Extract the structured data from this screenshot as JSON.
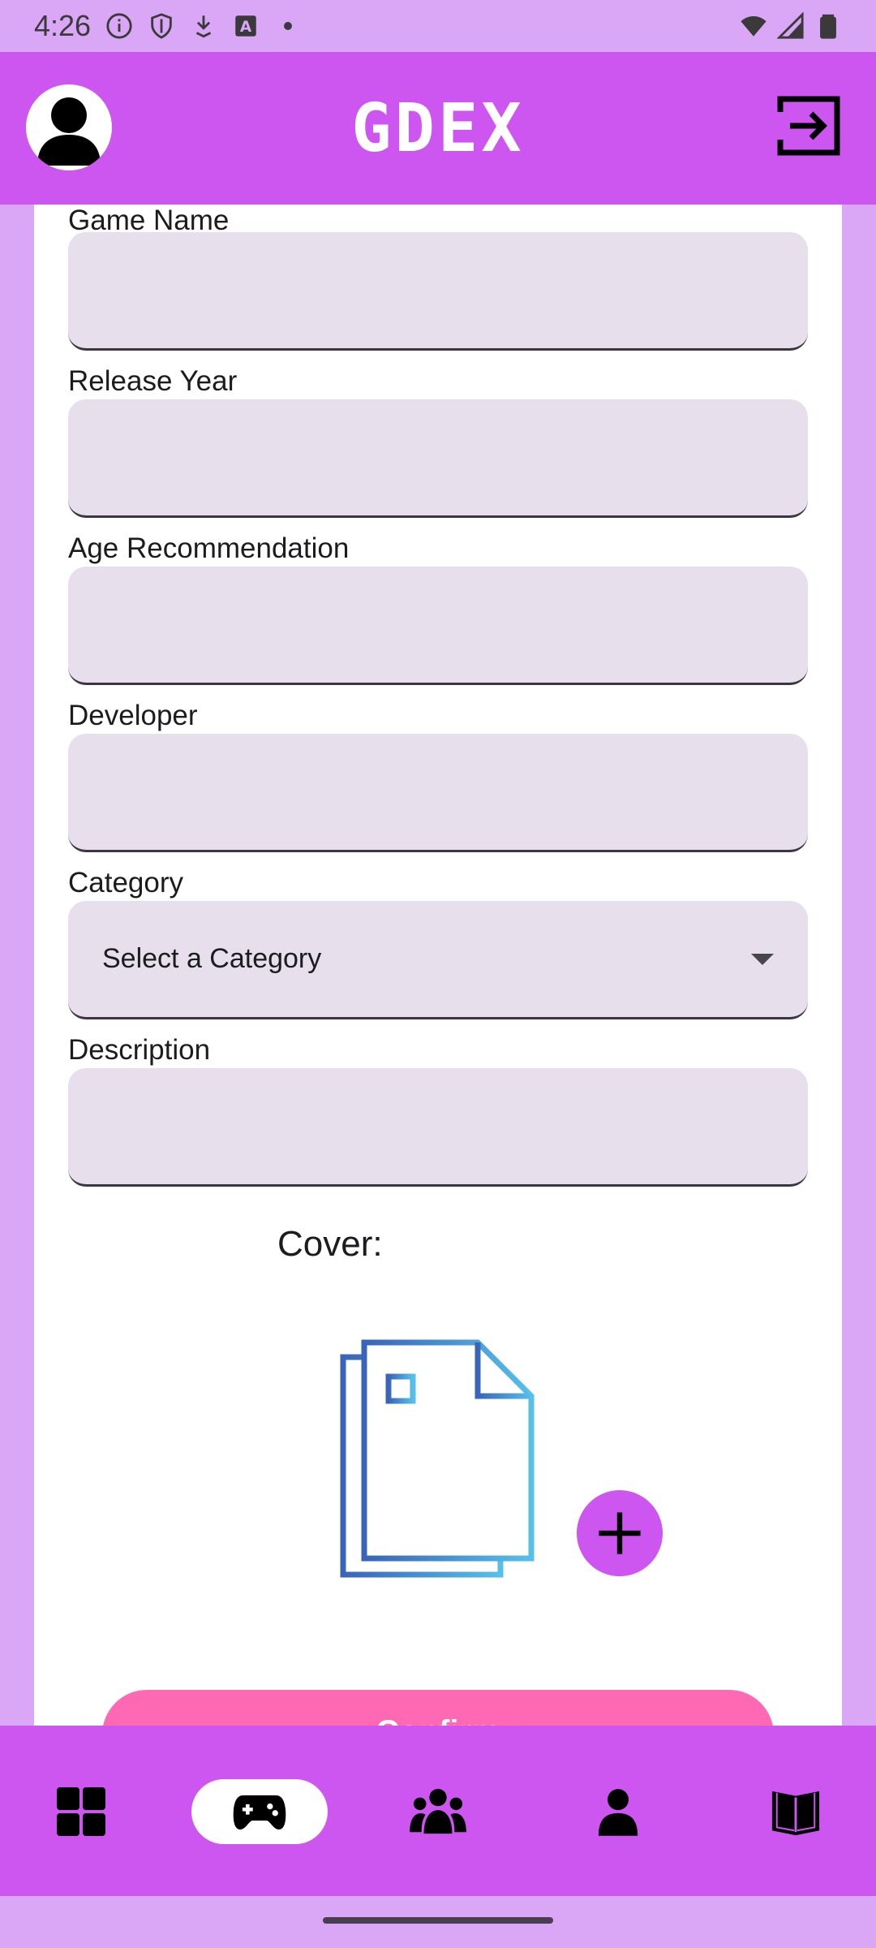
{
  "status_bar": {
    "time": "4:26",
    "icons": [
      "info-icon",
      "shield-icon",
      "download-icon",
      "font-icon",
      "dot-icon",
      "wifi-icon",
      "signal-icon",
      "battery-icon"
    ]
  },
  "app_bar": {
    "title": "GDEX",
    "avatar_icon": "person-icon",
    "logout_icon": "logout-icon",
    "color": "#cd55f0"
  },
  "form": {
    "game_name": {
      "label": "Game Name",
      "value": ""
    },
    "release_year": {
      "label": "Release Year",
      "value": ""
    },
    "age_recommendation": {
      "label": "Age Recommendation",
      "value": ""
    },
    "developer": {
      "label": "Developer",
      "value": ""
    },
    "category": {
      "label": "Category",
      "selected": "Select a Category"
    },
    "description": {
      "label": "Description",
      "value": ""
    },
    "cover_label": "Cover:",
    "confirm_label": "Confirm"
  },
  "bottom_nav": {
    "items": [
      {
        "icon": "dashboard-icon",
        "active": false
      },
      {
        "icon": "gamepad-icon",
        "active": true
      },
      {
        "icon": "group-icon",
        "active": false
      },
      {
        "icon": "person-icon",
        "active": false
      },
      {
        "icon": "book-icon",
        "active": false
      }
    ]
  },
  "colors": {
    "background": "#d9a7f5",
    "accent": "#cd55f0",
    "input_fill": "#e7dfec",
    "confirm_button": "#ff69b4",
    "doc_icon_gradient": [
      "#3a64b8",
      "#56c0ea"
    ]
  }
}
